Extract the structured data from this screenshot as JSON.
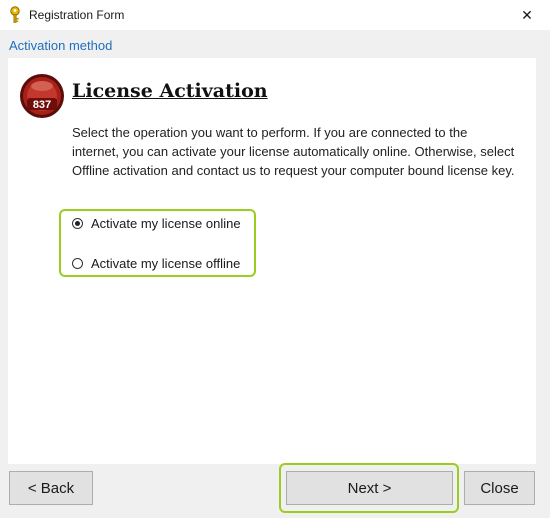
{
  "window": {
    "title": "Registration Form",
    "close_glyph": "✕",
    "icon": "key-icon"
  },
  "breadcrumb": "Activation method",
  "header": {
    "badge_text": "837",
    "heading": "License Activation"
  },
  "description": "Select the operation you want to perform. If you are connected to the internet, you can activate your license automatically online. Otherwise, select Offline activation and contact us to request your computer bound license key.",
  "options": [
    {
      "label": "Activate my license online",
      "checked": true
    },
    {
      "label": "Activate my license offline",
      "checked": false
    }
  ],
  "buttons": {
    "back": "< Back",
    "next": "Next >",
    "close": "Close"
  },
  "colors": {
    "highlight": "#9acd1f",
    "link": "#1f6fbf",
    "badge": "#a8201a"
  }
}
